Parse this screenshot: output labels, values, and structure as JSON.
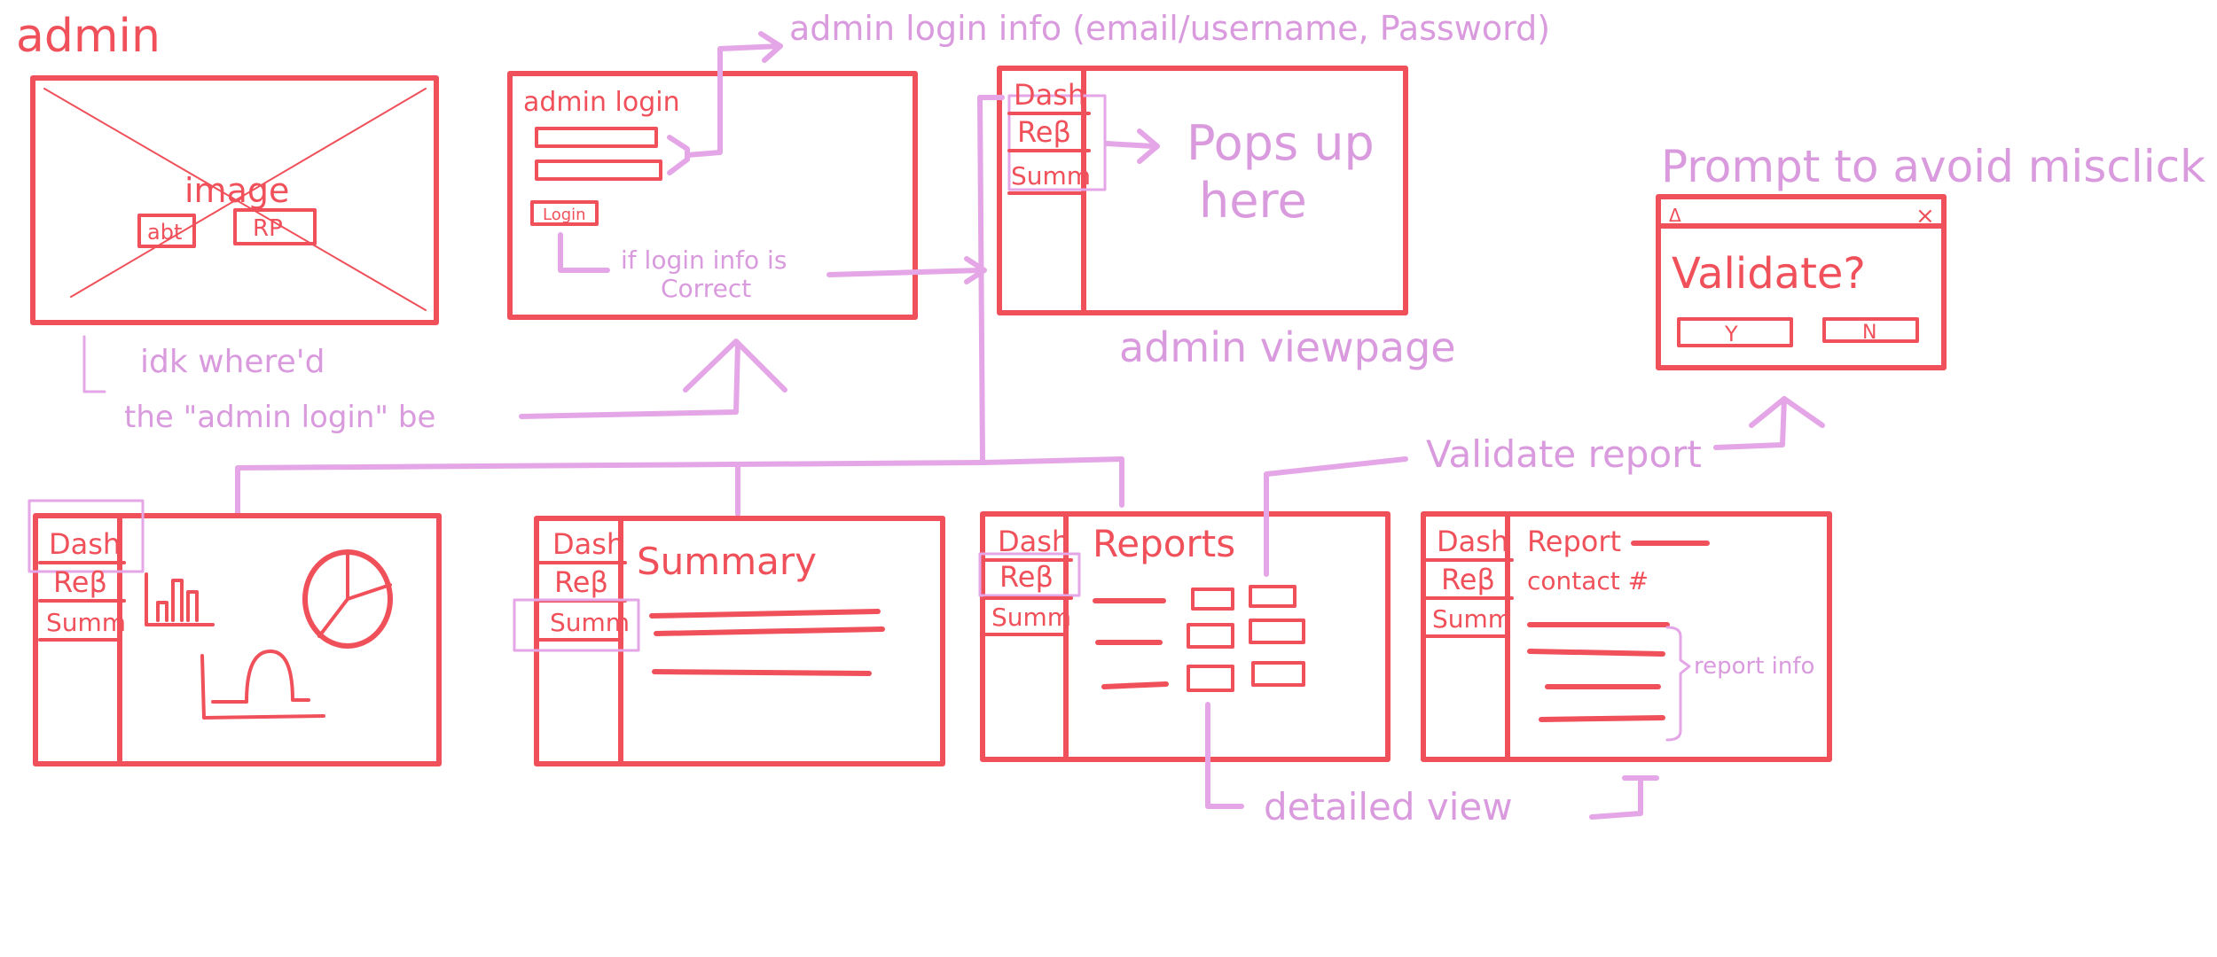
{
  "heading": "admin",
  "colors": {
    "frame": "#f0505a",
    "annotation": "#e4a6e6",
    "background": "#ffffff"
  },
  "image_placeholder": {
    "label": "image",
    "left_button": "abt",
    "right_button": "RP"
  },
  "login": {
    "title": "admin login",
    "button": "Login",
    "info_note": "admin login info (email/username, Password)",
    "correct_note_1": "if login info is",
    "correct_note_2": "Correct"
  },
  "admin_view": {
    "popup_1": "Pops up",
    "popup_2": "here",
    "caption": "admin viewpage"
  },
  "nav": {
    "dash": "Dash",
    "rep": "Reβ",
    "summ": "Summ"
  },
  "idk_note_1": "idk where'd",
  "idk_note_2": "the \"admin login\" be",
  "prompt": {
    "note": "Prompt to avoid misclick",
    "close": "×",
    "corner": "Δ",
    "question": "Validate?",
    "yes": "Y",
    "no": "N"
  },
  "summary_title": "Summary",
  "reports_title": "Reports",
  "report_detail": {
    "title": "Report",
    "contact": "contact #",
    "info": "report info"
  },
  "validate_report_note": "Validate report",
  "detailed_view_note": "detailed view"
}
